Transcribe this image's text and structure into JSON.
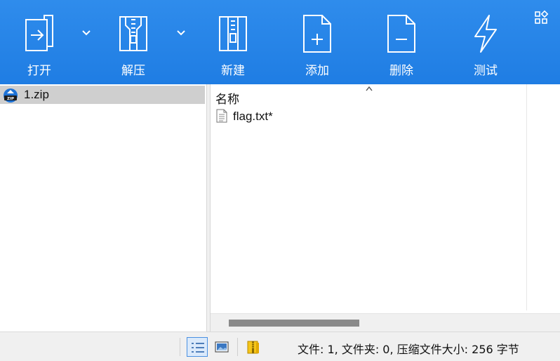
{
  "toolbar": {
    "buttons": [
      {
        "label": "打开",
        "icon": "open-icon"
      },
      {
        "label": "解压",
        "icon": "extract-icon"
      },
      {
        "label": "新建",
        "icon": "new-archive-icon"
      },
      {
        "label": "添加",
        "icon": "add-icon"
      },
      {
        "label": "删除",
        "icon": "delete-icon"
      },
      {
        "label": "测试",
        "icon": "test-icon"
      }
    ],
    "accent": "#2a87ea"
  },
  "tree": {
    "items": [
      {
        "label": "1.zip",
        "icon": "zip-icon"
      }
    ]
  },
  "file_list": {
    "column_name": "名称",
    "files": [
      {
        "name": "flag.txt*",
        "icon": "text-file-icon"
      }
    ]
  },
  "statusbar": {
    "text": "文件: 1, 文件夹: 0, 压缩文件大小: 256 字节"
  }
}
